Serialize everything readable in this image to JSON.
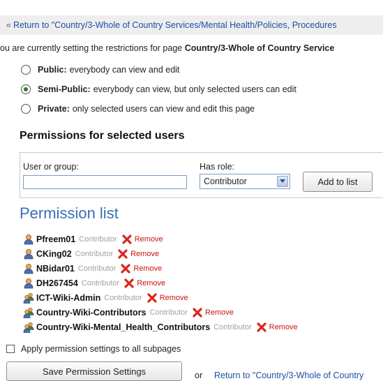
{
  "top_link": {
    "raquo": "«",
    "text": "Return to \"Country/3-Whole of Country Services/Mental Health/Policies, Procedures"
  },
  "intro": {
    "prefix": "ou are currently setting the restrictions for page ",
    "page": "Country/3-Whole of Country Service"
  },
  "options": [
    {
      "title": "Public:",
      "desc": "everybody can view and edit",
      "checked": false
    },
    {
      "title": "Semi-Public:",
      "desc": "everybody can view, but only selected users can edit",
      "checked": true
    },
    {
      "title": "Private:",
      "desc": "only selected users can view and edit this page",
      "checked": false
    }
  ],
  "permissions_heading": "Permissions for selected users",
  "form": {
    "user_label": "User or group:",
    "user_value": "",
    "role_label": "Has role:",
    "role_value": "Contributor",
    "add_button": "Add to list"
  },
  "permission_list_heading": "Permission list",
  "permissions": [
    {
      "name": "Pfreem01",
      "role": "Contributor",
      "remove": "Remove",
      "type": "user"
    },
    {
      "name": "CKing02",
      "role": "Contributor",
      "remove": "Remove",
      "type": "user"
    },
    {
      "name": "NBidar01",
      "role": "Contributor",
      "remove": "Remove",
      "type": "user"
    },
    {
      "name": "DH267454",
      "role": "Contributor",
      "remove": "Remove",
      "type": "user"
    },
    {
      "name": "ICT-Wiki-Admin",
      "role": "Contributor",
      "remove": "Remove",
      "type": "group"
    },
    {
      "name": "Country-Wiki-Contributors",
      "role": "Contributor",
      "remove": "Remove",
      "type": "group"
    },
    {
      "name": "Country-Wiki-Mental_Health_Contributors",
      "role": "Contributor",
      "remove": "Remove",
      "type": "group"
    }
  ],
  "apply_subpages": {
    "label": "Apply permission settings to all subpages",
    "checked": false
  },
  "save_button": "Save Permission Settings",
  "or_text": "or",
  "bottom_link": "Return to \"Country/3-Whole of Country"
}
